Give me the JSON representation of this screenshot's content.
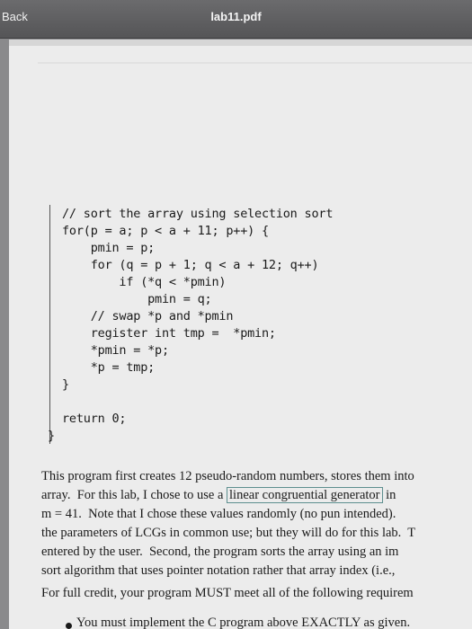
{
  "toolbar": {
    "back_label": "Back",
    "title": "lab11.pdf"
  },
  "code": {
    "lines": [
      "// sort the array using selection sort",
      "for(p = a; p < a + 11; p++) {",
      "    pmin = p;",
      "    for (q = p + 1; q < a + 12; q++)",
      "        if (*q < *pmin)",
      "            pmin = q;",
      "    // swap *p and *pmin",
      "    register int tmp =  *pmin;",
      "    *pmin = *p;",
      "    *p = tmp;",
      "}",
      "return 0;",
      "}"
    ]
  },
  "prose": {
    "line1": "This program first creates 12 pseudo-random numbers, stores them into",
    "line2_before": "array.  For this lab, I chose to use a ",
    "line2_link": "linear congruential generator",
    "line2_after": " in",
    "line3": "m = 41.  Note that I chose these values randomly (no pun intended).",
    "line4": "the parameters of LCGs in common use; but they will do for this lab.  T",
    "line5": "entered by the user.  Second, the program sorts the array using an im",
    "line6": "sort algorithm that uses pointer notation rather that array index (i.e.,",
    "line7": "For full credit, your program MUST meet all of the following requirem",
    "bullet1": "You must implement the C program above EXACTLY as given."
  }
}
